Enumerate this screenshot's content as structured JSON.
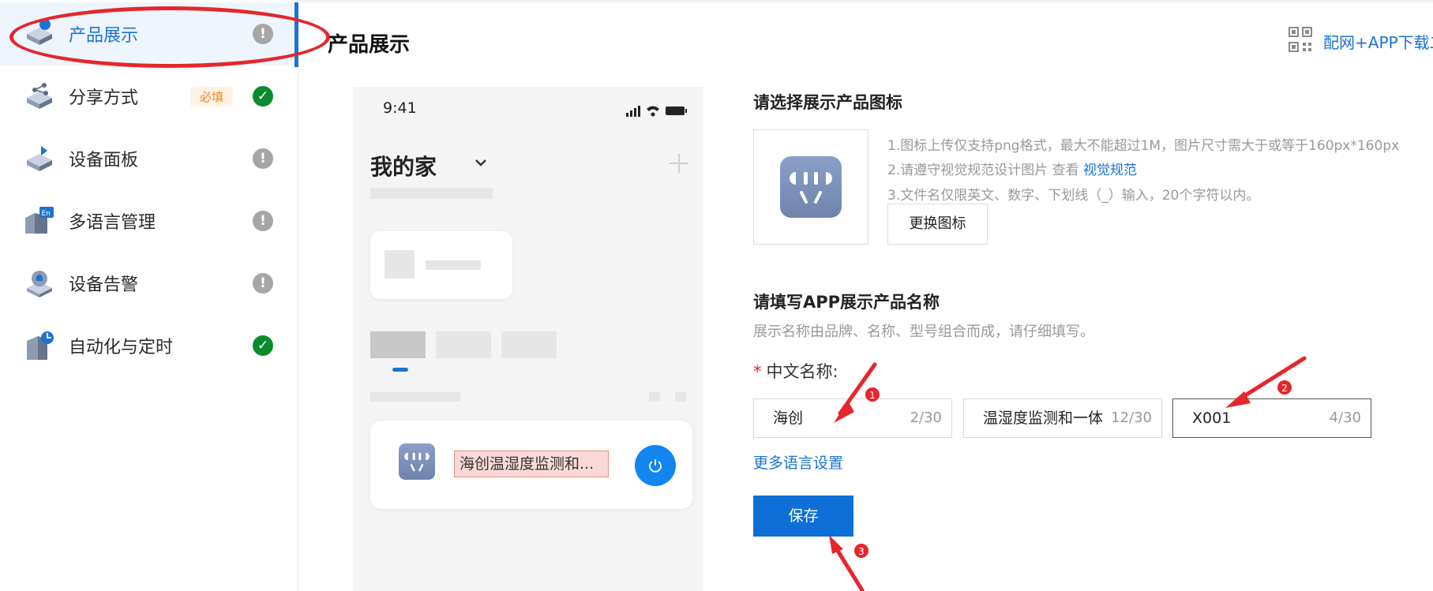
{
  "sidebar": {
    "items": [
      {
        "label": "产品展示",
        "icon": "product-display-icon",
        "status": "warn",
        "active": true
      },
      {
        "label": "分享方式",
        "icon": "share-method-icon",
        "status": "ok",
        "badge": "必填"
      },
      {
        "label": "设备面板",
        "icon": "device-panel-icon",
        "status": "warn"
      },
      {
        "label": "多语言管理",
        "icon": "multilanguage-icon",
        "status": "warn"
      },
      {
        "label": "设备告警",
        "icon": "device-alarm-icon",
        "status": "warn"
      },
      {
        "label": "自动化与定时",
        "icon": "automation-timer-icon",
        "status": "ok"
      }
    ],
    "status_glyphs": {
      "warn": "!",
      "ok": "✓"
    }
  },
  "header": {
    "title": "产品展示",
    "qr_link": "配网+APP下载二"
  },
  "phone_preview": {
    "time": "9:41",
    "home_title": "我的家",
    "device_name": "海创温湿度监测和..."
  },
  "icon_section": {
    "title": "请选择展示产品图标",
    "hints": [
      "1.图标上传仅支持png格式，最大不能超过1M，图片尺寸需大于或等于160px*160px",
      "2.请遵守视觉规范设计图片 查看",
      "3.文件名仅限英文、数字、下划线（_）输入，20个字符以内。"
    ],
    "hint_link": "视觉规范",
    "change_button": "更换图标"
  },
  "name_section": {
    "title": "请填写APP展示产品名称",
    "description": "展示名称由品牌、名称、型号组合而成，请仔细填写。",
    "required_star": "*",
    "field_label": "中文名称:",
    "inputs": [
      {
        "value": "海创",
        "count": "2/30"
      },
      {
        "value": "温湿度监测和一体",
        "count": "12/30"
      },
      {
        "value": "X001",
        "count": "4/30"
      }
    ],
    "more_link": "更多语言设置",
    "save_button": "保存"
  },
  "annotations": {
    "markers": [
      "1",
      "2",
      "3"
    ],
    "color": "#e5262b"
  },
  "colors": {
    "accent": "#1b73d2",
    "ok": "#0b8b2d",
    "warn": "#a6a6a6",
    "annotation": "#e5262b"
  }
}
